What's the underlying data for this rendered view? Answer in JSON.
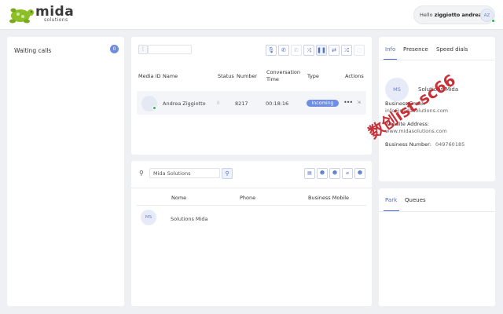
{
  "header": {
    "logo_word": "mida",
    "logo_sub": "solutions",
    "hello_prefix": "Hello",
    "user_name": "ziggiotto andrea",
    "user_initials": "AZ"
  },
  "waiting_calls": {
    "title": "Waiting calls",
    "count": "0"
  },
  "calls": {
    "toolbar_icons": [
      "mic-icon",
      "hold-icon",
      "hangup-icon",
      "transfer-icon",
      "pause-icon",
      "swap-icon",
      "shuffle-icon",
      "hide-icon"
    ],
    "columns": [
      "Media ID",
      "Name",
      "Status",
      "Number",
      "Conversation Time",
      "Type",
      "Actions"
    ],
    "rows": [
      {
        "name": "Andrea Ziggiotto",
        "status": "II",
        "number": "8217",
        "time": "00:18:16",
        "type": "Incoming",
        "actions": "•••"
      }
    ]
  },
  "contacts": {
    "search_value": "Mida Solutions",
    "columns": [
      "Nome",
      "Phone",
      "Business Mobile"
    ],
    "rows": [
      {
        "initials": "MS",
        "name": "Solutions Mida",
        "phone": "",
        "mobile": ""
      }
    ]
  },
  "info_panel": {
    "tabs": [
      "Info",
      "Presence",
      "Speed dials"
    ],
    "active_tab": "Info",
    "avatar_initials": "MS",
    "name": "Solutions Mida",
    "business_email_label": "Business Email:",
    "business_email": "info@midasolutions.com",
    "website_label": "Website Address:",
    "website": "www.midasolutions.com",
    "business_number_label": "Business Number:",
    "business_number": "049760185"
  },
  "park_panel": {
    "tabs": [
      "Park",
      "Queues"
    ],
    "active_tab": "Park"
  },
  "watermark": "数创ist-sc66",
  "colors": {
    "accent": "#4d6bc9",
    "badge": "#6f8ee3",
    "online": "#2fb34e",
    "logo_green": "#8cbf26",
    "watermark": "#c32027"
  }
}
